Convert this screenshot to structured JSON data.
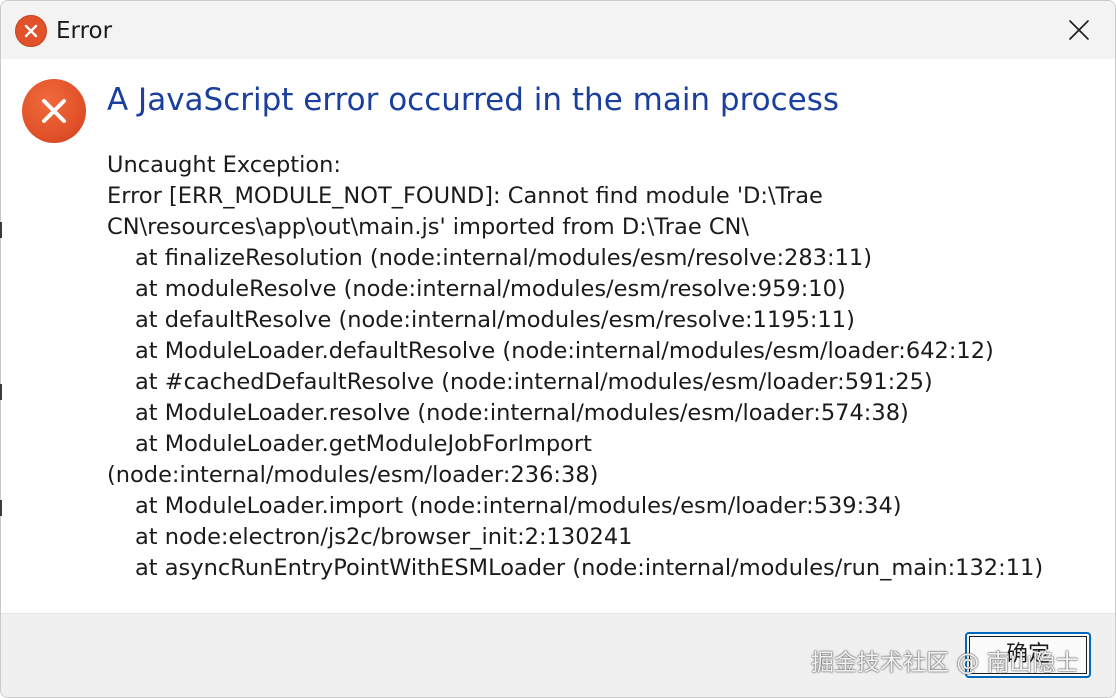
{
  "window": {
    "title": "Error",
    "icons": {
      "title": "error-icon",
      "close": "close-icon",
      "main": "error-circle-icon"
    }
  },
  "dialog": {
    "heading": "A JavaScript error occurred in the main process",
    "lines": [
      "Uncaught Exception:",
      "Error [ERR_MODULE_NOT_FOUND]: Cannot find module 'D:\\Trae",
      "CN\\resources\\app\\out\\main.js' imported from D:\\Trae CN\\",
      "at finalizeResolution (node:internal/modules/esm/resolve:283:11)",
      "at moduleResolve (node:internal/modules/esm/resolve:959:10)",
      "at defaultResolve (node:internal/modules/esm/resolve:1195:11)",
      "at ModuleLoader.defaultResolve (node:internal/modules/esm/loader:642:12)",
      "at #cachedDefaultResolve (node:internal/modules/esm/loader:591:25)",
      "at ModuleLoader.resolve (node:internal/modules/esm/loader:574:38)",
      "at ModuleLoader.getModuleJobForImport",
      "(node:internal/modules/esm/loader:236:38)",
      "at ModuleLoader.import (node:internal/modules/esm/loader:539:34)",
      "at node:electron/js2c/browser_init:2:130241",
      "at asyncRunEntryPointWithESMLoader (node:internal/modules/run_main:132:11)"
    ],
    "ok_label": "确定"
  },
  "watermark": "掘金技术社区 @ 南山隐士",
  "colors": {
    "accent": "#0067c0",
    "heading": "#1a3f9c",
    "error": "#e2522a"
  }
}
